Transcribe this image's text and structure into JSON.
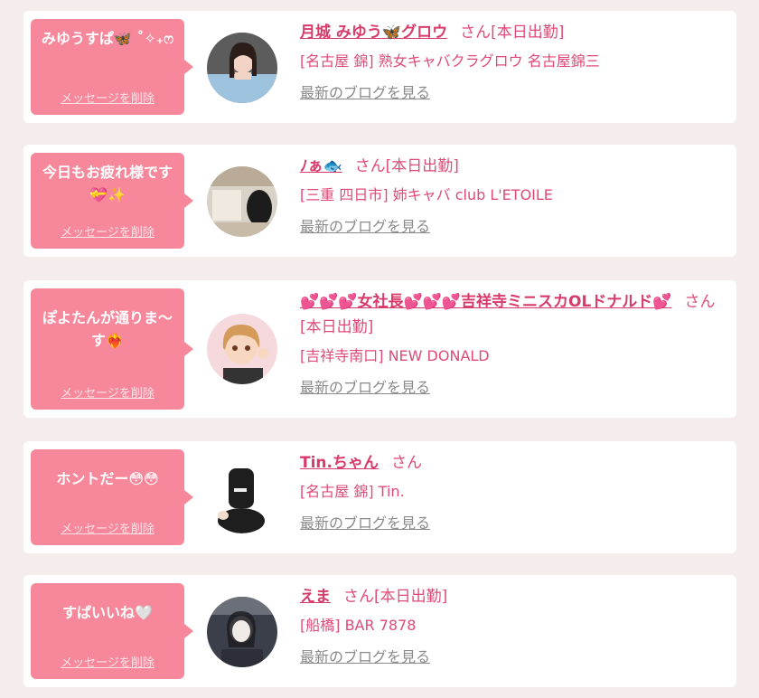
{
  "theme": {
    "background": "#f5ecee",
    "bubble": "#f7879a",
    "name_color": "#d83a6a",
    "text_pink": "#e04a78",
    "link_gray": "#8a8a8a"
  },
  "delete_label": "メッセージを削除",
  "blog_label": "最新のブログを見る",
  "items": [
    {
      "message": "みゆうすぱ🦋 ˚✧₊ෆ",
      "name": "月城 みゆう🦋グロウ",
      "suffix": "さん",
      "status": "[本日出勤]",
      "shop": "[名古屋 錦] 熟女キャバクラグロウ 名古屋錦三"
    },
    {
      "message": "今日もお疲れ様です💝✨",
      "name": "ﾉぁ🐟",
      "suffix": "さん",
      "status": "[本日出勤]",
      "shop": "[三重 四日市] 姉キャバ club L'ETOILE"
    },
    {
      "message": "ぽよたんが通りま～す❤️‍🔥",
      "name": "💕💕💕女社長💕💕💕吉祥寺ミニスカOLドナルド💕",
      "suffix": "さん",
      "status": "[本日出勤]",
      "shop": "[吉祥寺南口] NEW DONALD"
    },
    {
      "message": "ホントだー😳😳",
      "name": "Tin.ちゃん",
      "suffix": "さん",
      "status": "",
      "shop": "[名古屋 錦] Tin."
    },
    {
      "message": "すぱいいね🤍",
      "name": "えま",
      "suffix": "さん",
      "status": "[本日出勤]",
      "shop": "[船橋] BAR 7878"
    }
  ]
}
